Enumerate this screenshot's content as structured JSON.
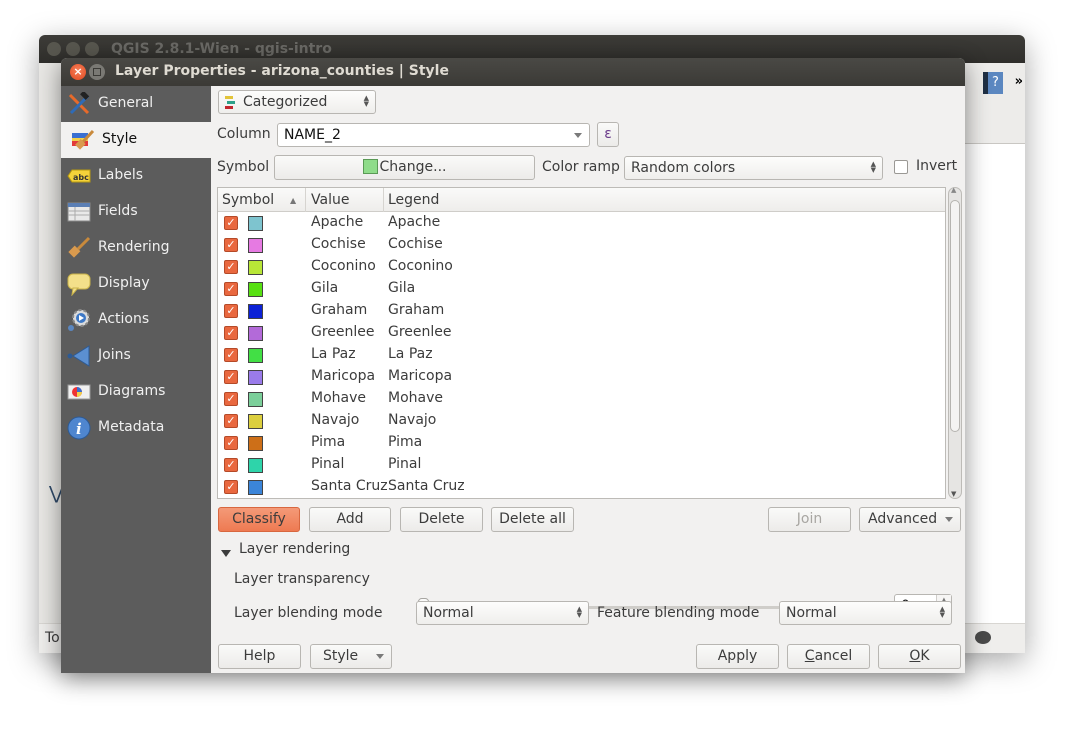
{
  "background_window": {
    "title": "QGIS 2.8.1-Wien - qgis-intro",
    "status_text": "To",
    "toolbar_overflow": "»"
  },
  "dialog": {
    "title": "Layer Properties - arizona_counties | Style"
  },
  "sidebar": {
    "items": [
      {
        "label": "General",
        "icon": "hammer-wrench-icon"
      },
      {
        "label": "Style",
        "icon": "paint-brush-icon",
        "active": true
      },
      {
        "label": "Labels",
        "icon": "abc-label-icon"
      },
      {
        "label": "Fields",
        "icon": "table-icon"
      },
      {
        "label": "Rendering",
        "icon": "brush-icon"
      },
      {
        "label": "Display",
        "icon": "speech-bubble-icon"
      },
      {
        "label": "Actions",
        "icon": "gear-play-icon"
      },
      {
        "label": "Joins",
        "icon": "join-arrow-icon"
      },
      {
        "label": "Diagrams",
        "icon": "pie-chart-icon"
      },
      {
        "label": "Metadata",
        "icon": "info-icon"
      }
    ]
  },
  "style": {
    "renderer": "Categorized",
    "column_label": "Column",
    "column_value": "NAME_2",
    "expression_button": "ε",
    "symbol_label": "Symbol",
    "symbol_change": "Change...",
    "symbol_color": "#8fdc8a",
    "color_ramp_label": "Color ramp",
    "color_ramp_value": "Random colors",
    "invert_label": "Invert",
    "invert_checked": false
  },
  "table": {
    "headers": [
      "Symbol",
      "Value",
      "Legend"
    ],
    "sort_indicator": "▲",
    "rows": [
      {
        "value": "Apache",
        "legend": "Apache",
        "color": "#7ec4cf",
        "checked": true
      },
      {
        "value": "Cochise",
        "legend": "Cochise",
        "color": "#e67ae2",
        "checked": true
      },
      {
        "value": "Coconino",
        "legend": "Coconino",
        "color": "#b8e637",
        "checked": true
      },
      {
        "value": "Gila",
        "legend": "Gila",
        "color": "#57e012",
        "checked": true
      },
      {
        "value": "Graham",
        "legend": "Graham",
        "color": "#0c22d6",
        "checked": true
      },
      {
        "value": "Greenlee",
        "legend": "Greenlee",
        "color": "#b36ad9",
        "checked": true
      },
      {
        "value": "La Paz",
        "legend": "La Paz",
        "color": "#42df45",
        "checked": true
      },
      {
        "value": "Maricopa",
        "legend": "Maricopa",
        "color": "#9a7bea",
        "checked": true
      },
      {
        "value": "Mohave",
        "legend": "Mohave",
        "color": "#7bcf9a",
        "checked": true
      },
      {
        "value": "Navajo",
        "legend": "Navajo",
        "color": "#dccf3e",
        "checked": true
      },
      {
        "value": "Pima",
        "legend": "Pima",
        "color": "#cd6f18",
        "checked": true
      },
      {
        "value": "Pinal",
        "legend": "Pinal",
        "color": "#2ed4aa",
        "checked": true
      },
      {
        "value": "Santa Cruz",
        "legend": "Santa Cruz",
        "color": "#3b85d9",
        "checked": true
      }
    ]
  },
  "actions": {
    "classify": "Classify",
    "add": "Add",
    "delete": "Delete",
    "delete_all": "Delete all",
    "join": "Join",
    "advanced": "Advanced"
  },
  "layer_rendering": {
    "section_title": "Layer rendering",
    "transparency_label": "Layer transparency",
    "transparency_value": "0",
    "transparency_fraction": 0,
    "layer_blend_label": "Layer blending mode",
    "layer_blend_value": "Normal",
    "feature_blend_label": "Feature blending mode",
    "feature_blend_value": "Normal"
  },
  "footer": {
    "help": "Help",
    "style": "Style",
    "apply": "Apply",
    "cancel_prefix": "",
    "cancel_mnemonic": "C",
    "cancel_rest": "ancel",
    "ok_mnemonic": "O",
    "ok_rest": "K"
  }
}
